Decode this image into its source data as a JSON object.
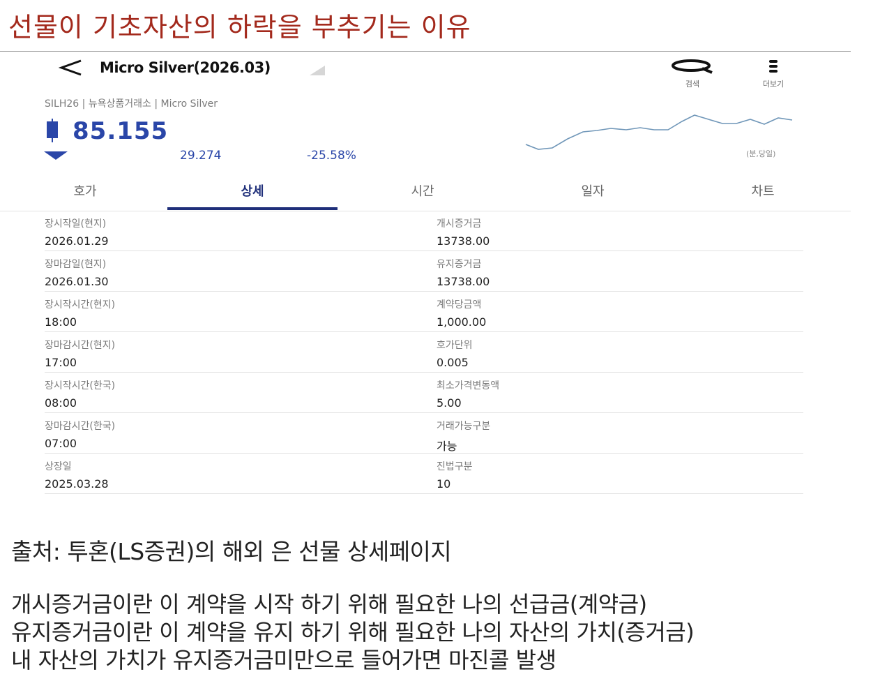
{
  "slide": {
    "title": "선물이 기초자산의 하락을 부추기는 이유"
  },
  "header": {
    "back_icon": "<",
    "instrument_title": "Micro Silver(2026.03)",
    "search_label": "검색",
    "more_label": "더보기"
  },
  "quote": {
    "subinfo": "SILH26 | 뉴욕상품거래소 | Micro Silver",
    "price": "85.155",
    "change": "29.274",
    "change_pct": "-25.58%",
    "chart_unit": "(분,당일)",
    "colors": {
      "down": "#2a46a8",
      "sparkline": "#6f96b8"
    }
  },
  "tabs": [
    {
      "label": "호가",
      "active": false
    },
    {
      "label": "상세",
      "active": true
    },
    {
      "label": "시간",
      "active": false
    },
    {
      "label": "일자",
      "active": false
    },
    {
      "label": "차트",
      "active": false
    }
  ],
  "details": [
    {
      "left": {
        "label": "장시작일(현지)",
        "value": "2026.01.29"
      },
      "right": {
        "label": "개시증거금",
        "value": "13738.00"
      }
    },
    {
      "left": {
        "label": "장마감일(현지)",
        "value": "2026.01.30"
      },
      "right": {
        "label": "유지증거금",
        "value": "13738.00"
      }
    },
    {
      "left": {
        "label": "장시작시간(현지)",
        "value": "18:00"
      },
      "right": {
        "label": "계약당금액",
        "value": "1,000.00"
      }
    },
    {
      "left": {
        "label": "장마감시간(현지)",
        "value": "17:00"
      },
      "right": {
        "label": "호가단위",
        "value": "0.005"
      }
    },
    {
      "left": {
        "label": "장시작시간(한국)",
        "value": "08:00"
      },
      "right": {
        "label": "최소가격변동액",
        "value": "5.00"
      }
    },
    {
      "left": {
        "label": "장마감시간(한국)",
        "value": "07:00"
      },
      "right": {
        "label": "거래가능구분",
        "value": "가능"
      }
    },
    {
      "left": {
        "label": "상장일",
        "value": "2025.03.28"
      },
      "right": {
        "label": "진법구분",
        "value": "10"
      }
    }
  ],
  "notes": {
    "source": "출처: 투혼(LS증권)의 해외 은 선물 상세페이지",
    "lines": [
      "개시증거금이란 이 계약을  시작 하기 위해 필요한 나의 선급금(계약금)",
      "유지증거금이란 이 계약을 유지 하기 위해 필요한 나의 자산의 가치(증거금)",
      "내 자산의 가치가 유지증거금미만으로 들어가면 마진콜 발생"
    ]
  }
}
